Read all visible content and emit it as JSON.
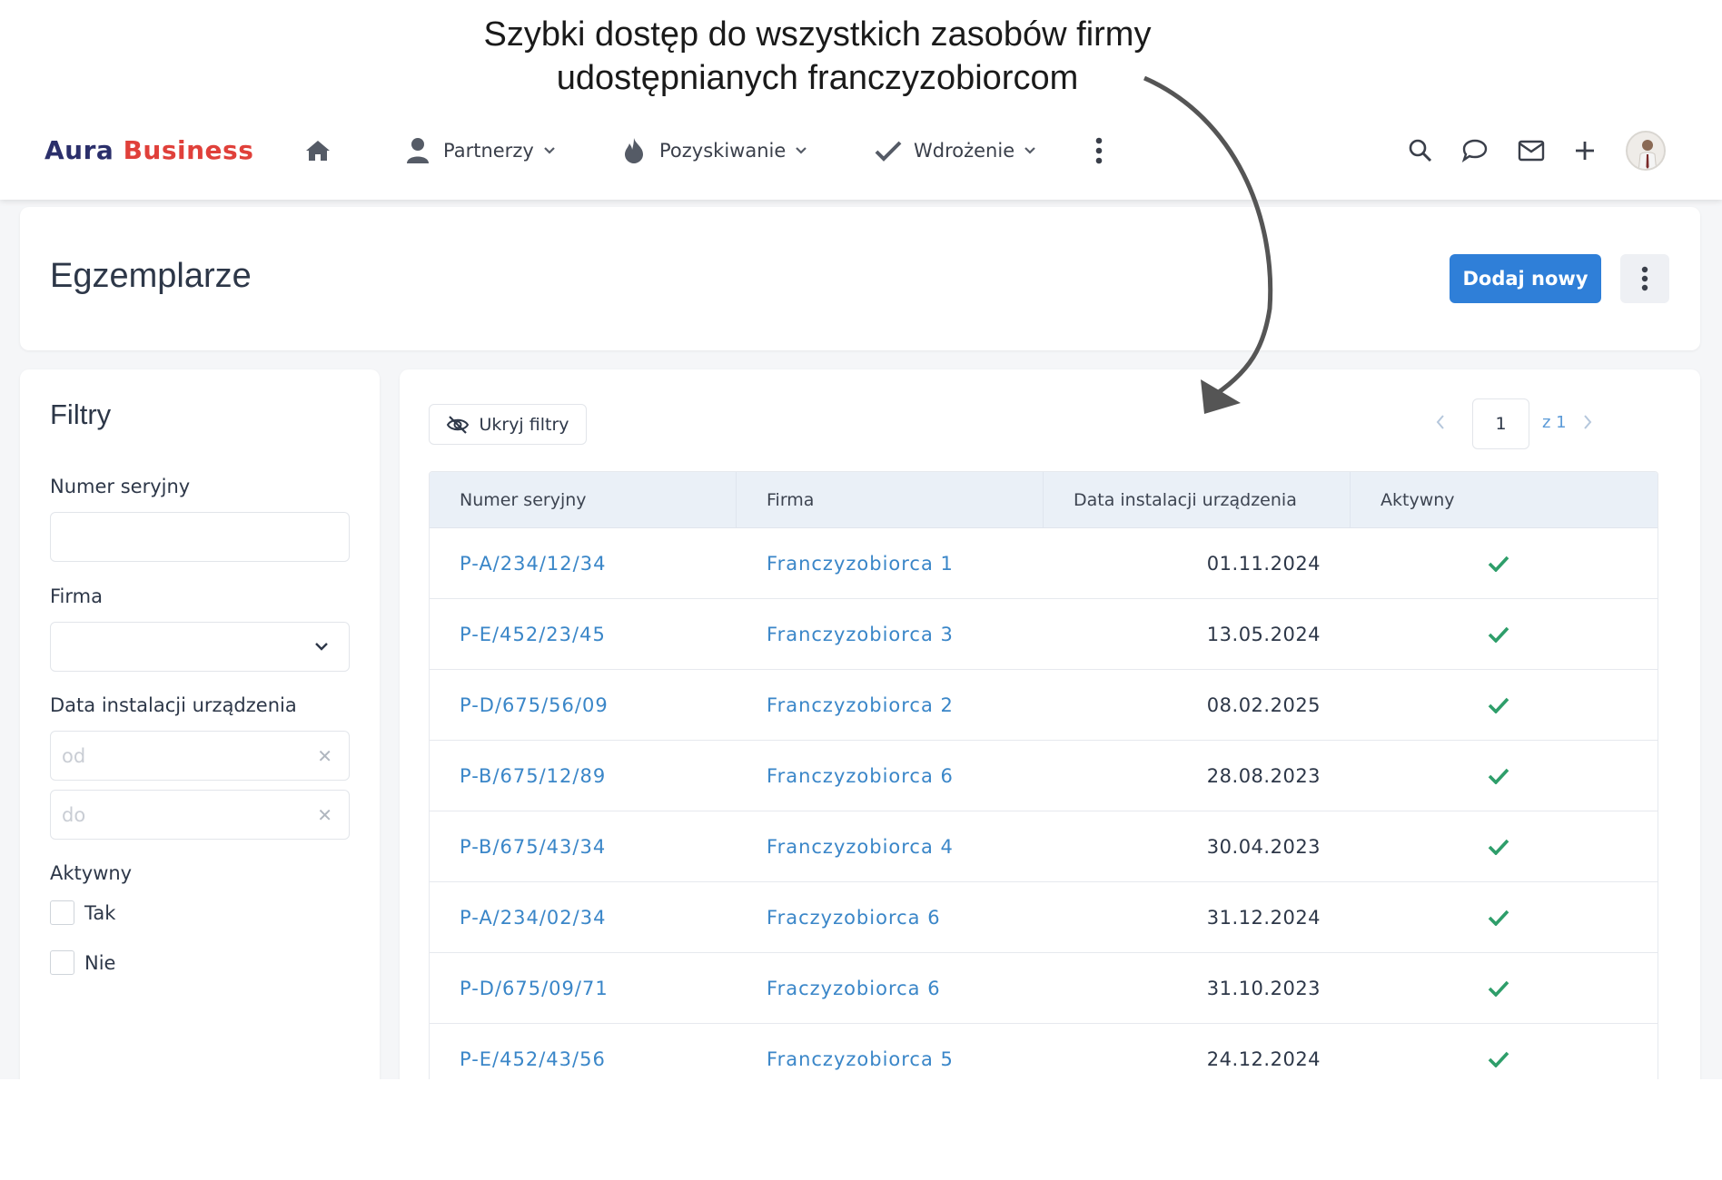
{
  "caption": {
    "line1": "Szybki dostęp do wszystkich zasobów firmy",
    "line2": "udostępnianych franczyzobiorcom"
  },
  "navbar": {
    "logo_part1": "Aura",
    "logo_part2": "Business",
    "items": [
      {
        "label": "Partnerzy",
        "icon": "user-icon"
      },
      {
        "label": "Pozyskiwanie",
        "icon": "fire-icon"
      },
      {
        "label": "Wdrożenie",
        "icon": "check-icon"
      }
    ],
    "actions": [
      "search-icon",
      "chat-icon",
      "mail-icon",
      "plus-icon",
      "avatar"
    ]
  },
  "page": {
    "title": "Egzemplarze",
    "add_button": "Dodaj nowy"
  },
  "filters": {
    "title": "Filtry",
    "serial_label": "Numer seryjny",
    "serial_value": "",
    "company_label": "Firma",
    "company_value": "",
    "date_label": "Data instalacji urządzenia",
    "date_from_placeholder": "od",
    "date_to_placeholder": "do",
    "active_label": "Aktywny",
    "active_options": [
      "Tak",
      "Nie"
    ]
  },
  "toolbar": {
    "hide_filters": "Ukryj filtry",
    "page_current": "1",
    "page_of": "z 1"
  },
  "table": {
    "columns": [
      "Numer seryjny",
      "Firma",
      "Data instalacji urządzenia",
      "Aktywny"
    ],
    "rows": [
      {
        "serial": "P-A/234/12/34",
        "company": "Franczyzobiorca 1",
        "date": "01.11.2024",
        "active": true
      },
      {
        "serial": "P-E/452/23/45",
        "company": "Franczyzobiorca 3",
        "date": "13.05.2024",
        "active": true
      },
      {
        "serial": "P-D/675/56/09",
        "company": "Franczyzobiorca 2",
        "date": "08.02.2025",
        "active": true
      },
      {
        "serial": "P-B/675/12/89",
        "company": "Franczyzobiorca 6",
        "date": "28.08.2023",
        "active": true
      },
      {
        "serial": "P-B/675/43/34",
        "company": "Franczyzobiorca 4",
        "date": "30.04.2023",
        "active": true
      },
      {
        "serial": "P-A/234/02/34",
        "company": "Fraczyzobiorca 6",
        "date": "31.12.2024",
        "active": true
      },
      {
        "serial": "P-D/675/09/71",
        "company": "Fraczyzobiorca 6",
        "date": "31.10.2023",
        "active": true
      },
      {
        "serial": "P-E/452/43/56",
        "company": "Franczyzobiorca 5",
        "date": "24.12.2024",
        "active": true
      }
    ]
  },
  "colors": {
    "brand_dark": "#2b2f6b",
    "brand_red": "#e0403a",
    "primary": "#2f7fd8",
    "link": "#3a86c8",
    "check": "#2e9e6a"
  }
}
